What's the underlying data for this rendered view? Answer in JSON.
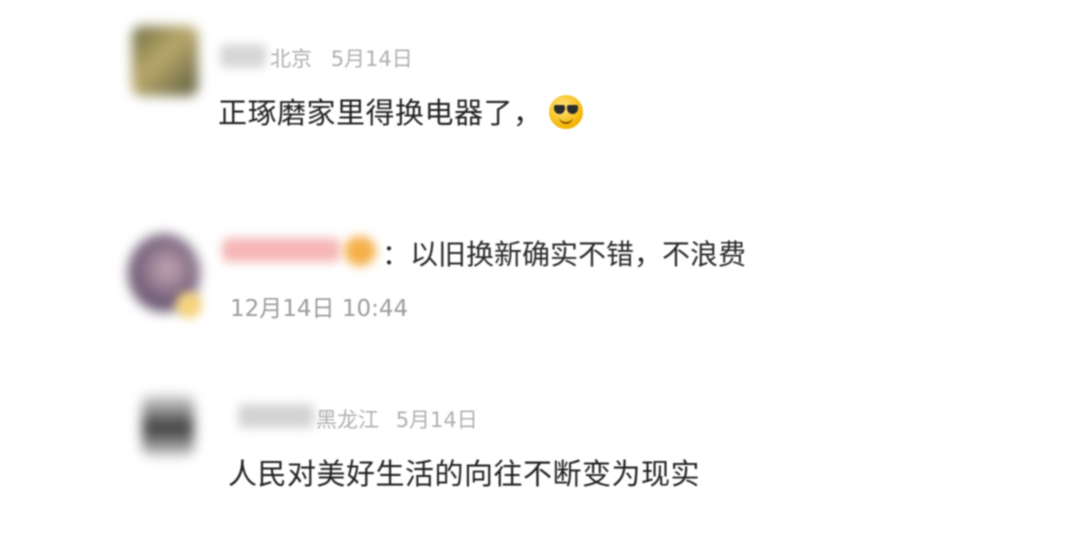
{
  "comments": [
    {
      "location": "北京",
      "date": "5月14日",
      "text": "正琢磨家里得换电器了，",
      "emoji_icon": "sunglasses-emoji-icon"
    },
    {
      "reply_text": "：以旧换新确实不错，不浪费",
      "timestamp": "12月14日 10:44"
    },
    {
      "location": "黑龙江",
      "date": "5月14日",
      "text": "人民对美好生活的向往不断变为现实"
    }
  ],
  "colors": {
    "meta_text": "#b0b0b0",
    "body_text": "#222222",
    "username_blur_pink": "#f6b6b6",
    "badge_orange": "#f5b04a"
  }
}
